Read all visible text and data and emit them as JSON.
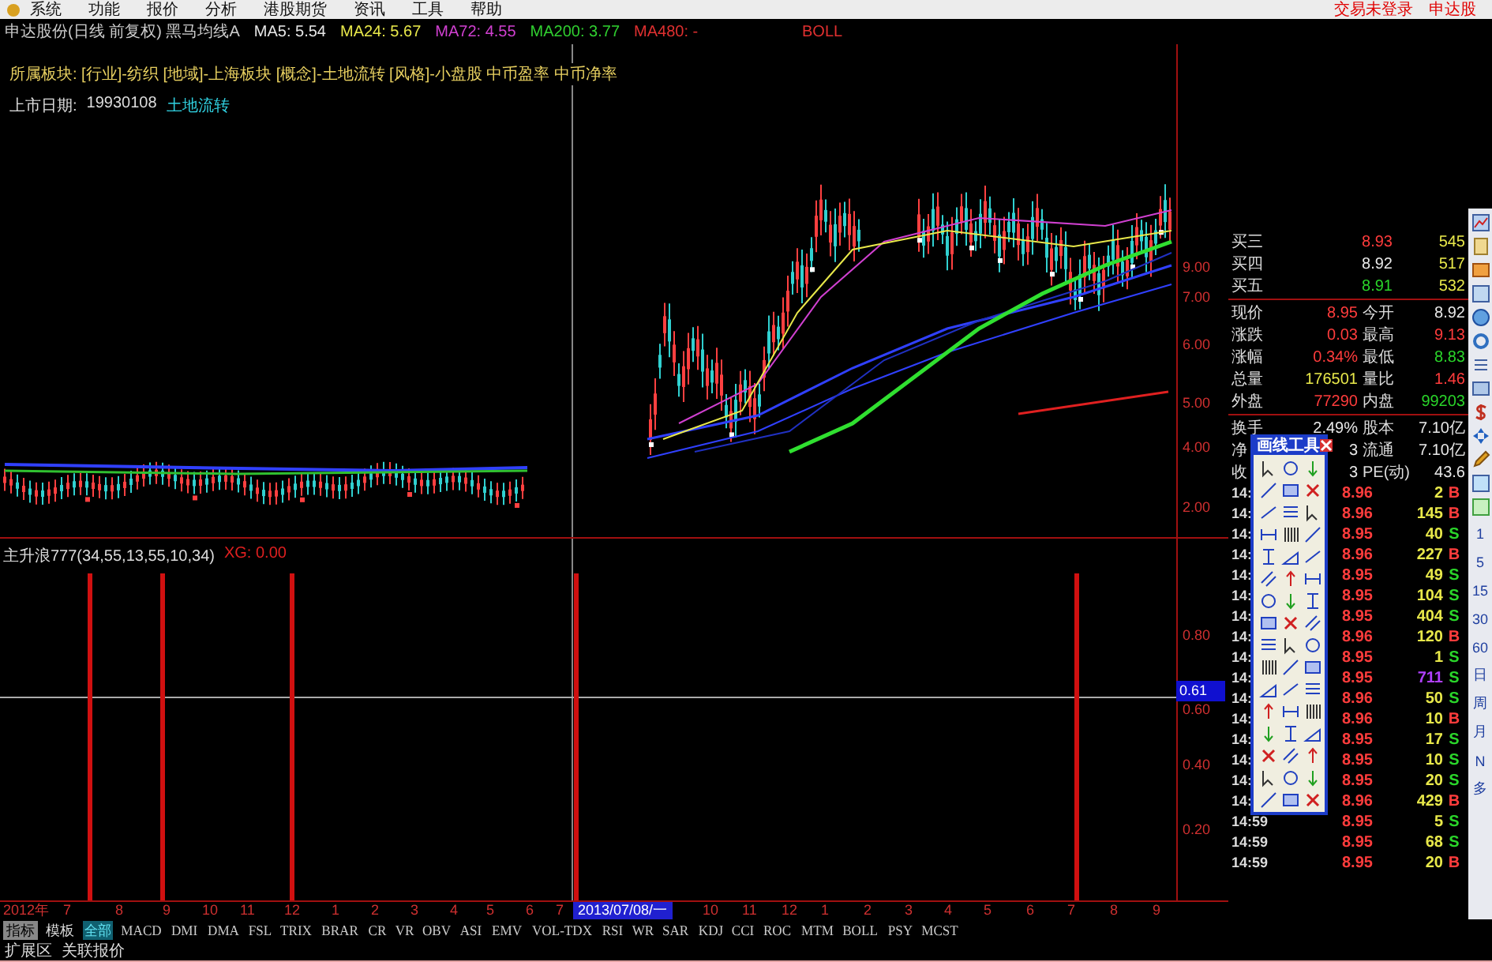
{
  "menu_bar": {
    "items": [
      "系统",
      "功能",
      "报价",
      "分析",
      "港股期货",
      "资讯",
      "工具",
      "帮助"
    ],
    "status": [
      "交易未登录",
      "申达股"
    ]
  },
  "chart_header": {
    "title": "申达股份(日线 前复权) 黑马均线A",
    "indicators": [
      {
        "label": "MA5: 5.54",
        "color": "#e6e6e6"
      },
      {
        "label": "MA24: 5.67",
        "color": "#e8e84a"
      },
      {
        "label": "MA72: 4.55",
        "color": "#d040d0"
      },
      {
        "label": "MA200: 3.77",
        "color": "#30d030"
      },
      {
        "label": "MA480: -",
        "color": "#e03030"
      }
    ],
    "extra": "BOLL"
  },
  "price_pane": {
    "sector": "所属板块: [行业]-纺织 [地域]-上海板块 [概念]-土地流转 [风格]-小盘股 中币盈率 中币净率",
    "listing": {
      "label": "上市日期:",
      "date": "19930108",
      "tag": "土地流转"
    },
    "axis_labels": [
      "9.00",
      "7.00",
      "6.00",
      "5.00",
      "4.00",
      "2.00"
    ]
  },
  "indicator_pane": {
    "name": "主升浪777(34,55,13,55,10,34)",
    "reading": "XG: 0.00",
    "axis_labels": [
      "0.80",
      "0.60",
      "0.40",
      "0.20"
    ],
    "cursor_value": "0.61"
  },
  "date_axis": [
    {
      "text": "2012年",
      "kind": "tick"
    },
    {
      "text": "7",
      "kind": "tick"
    },
    {
      "text": "8",
      "kind": "tick"
    },
    {
      "text": "9",
      "kind": "tick"
    },
    {
      "text": "10",
      "kind": "tick"
    },
    {
      "text": "11",
      "kind": "tick"
    },
    {
      "text": "12",
      "kind": "tick"
    },
    {
      "text": "1",
      "kind": "tick"
    },
    {
      "text": "2",
      "kind": "tick"
    },
    {
      "text": "3",
      "kind": "tick"
    },
    {
      "text": "4",
      "kind": "tick"
    },
    {
      "text": "5",
      "kind": "tick"
    },
    {
      "text": "6",
      "kind": "tick"
    },
    {
      "text": "7",
      "kind": "tick"
    },
    {
      "text": "2013/07/08/一",
      "kind": "cursor"
    },
    {
      "text": "10",
      "kind": "tick"
    },
    {
      "text": "11",
      "kind": "tick"
    },
    {
      "text": "12",
      "kind": "tick"
    },
    {
      "text": "1",
      "kind": "tick"
    },
    {
      "text": "2",
      "kind": "tick"
    },
    {
      "text": "3",
      "kind": "tick"
    },
    {
      "text": "4",
      "kind": "tick"
    },
    {
      "text": "5",
      "kind": "tick"
    },
    {
      "text": "6",
      "kind": "tick"
    },
    {
      "text": "7",
      "kind": "tick"
    },
    {
      "text": "8",
      "kind": "tick"
    },
    {
      "text": "9",
      "kind": "tick"
    }
  ],
  "quote": {
    "bids": [
      {
        "label": "买三",
        "price": "8.93",
        "color": "#ff3c3c",
        "volume": "545"
      },
      {
        "label": "买四",
        "price": "8.92",
        "color": "#e8e8e8",
        "volume": "517"
      },
      {
        "label": "买五",
        "price": "8.91",
        "color": "#2ad52a",
        "volume": "532"
      }
    ],
    "stats": [
      [
        {
          "label": "现价",
          "value": "8.95",
          "color": "#ff3c3c"
        },
        {
          "label": "今开",
          "value": "8.92",
          "color": "#e8e8e8"
        }
      ],
      [
        {
          "label": "涨跌",
          "value": "0.03",
          "color": "#ff3c3c"
        },
        {
          "label": "最高",
          "value": "9.13",
          "color": "#ff3c3c"
        }
      ],
      [
        {
          "label": "涨幅",
          "value": "0.34%",
          "color": "#ff3c3c"
        },
        {
          "label": "最低",
          "value": "8.83",
          "color": "#2ad52a"
        }
      ],
      [
        {
          "label": "总量",
          "value": "176501",
          "color": "#e8e84a"
        },
        {
          "label": "量比",
          "value": "1.46",
          "color": "#ff3c3c"
        }
      ],
      [
        {
          "label": "外盘",
          "value": "77290",
          "color": "#ff3c3c"
        },
        {
          "label": "内盘",
          "value": "99203",
          "color": "#2ad52a"
        }
      ]
    ],
    "stats2": [
      [
        {
          "label": "换手",
          "value": "2.49%",
          "color": "#e8e8e8"
        },
        {
          "label": "股本",
          "value": "7.10亿",
          "color": "#e8e8e8"
        }
      ],
      [
        {
          "label": "净",
          "value": "3",
          "color": "#e8e8e8"
        },
        {
          "label": "流通",
          "value": "7.10亿",
          "color": "#e8e8e8"
        }
      ],
      [
        {
          "label": "收",
          "value": "3",
          "color": "#e8e8e8"
        },
        {
          "label": "PE(动)",
          "value": "43.6",
          "color": "#e8e8e8"
        }
      ]
    ],
    "ticks": [
      {
        "time": "14:",
        "price": "8.96",
        "color": "#ff3c3c",
        "volume": "2",
        "large": false,
        "side": "B",
        "buy": true
      },
      {
        "time": "14:",
        "price": "8.96",
        "color": "#ff3c3c",
        "volume": "145",
        "large": false,
        "side": "B",
        "buy": true
      },
      {
        "time": "14:",
        "price": "8.95",
        "color": "#ff3c3c",
        "volume": "40",
        "large": false,
        "side": "S",
        "buy": false
      },
      {
        "time": "14:",
        "price": "8.96",
        "color": "#ff3c3c",
        "volume": "227",
        "large": false,
        "side": "B",
        "buy": true
      },
      {
        "time": "14:",
        "price": "8.95",
        "color": "#ff3c3c",
        "volume": "49",
        "large": false,
        "side": "S",
        "buy": false
      },
      {
        "time": "14:",
        "price": "8.95",
        "color": "#ff3c3c",
        "volume": "104",
        "large": false,
        "side": "S",
        "buy": false
      },
      {
        "time": "14:",
        "price": "8.95",
        "color": "#ff3c3c",
        "volume": "404",
        "large": false,
        "side": "S",
        "buy": false
      },
      {
        "time": "14:",
        "price": "8.96",
        "color": "#ff3c3c",
        "volume": "120",
        "large": false,
        "side": "B",
        "buy": true
      },
      {
        "time": "14:",
        "price": "8.95",
        "color": "#ff3c3c",
        "volume": "1",
        "large": false,
        "side": "S",
        "buy": false
      },
      {
        "time": "14:",
        "price": "8.95",
        "color": "#ff3c3c",
        "volume": "711",
        "large": true,
        "side": "S",
        "buy": false
      },
      {
        "time": "14:",
        "price": "8.96",
        "color": "#ff3c3c",
        "volume": "50",
        "large": false,
        "side": "S",
        "buy": false
      },
      {
        "time": "14:",
        "price": "8.96",
        "color": "#ff3c3c",
        "volume": "10",
        "large": false,
        "side": "B",
        "buy": true
      },
      {
        "time": "14:",
        "price": "8.95",
        "color": "#ff3c3c",
        "volume": "17",
        "large": false,
        "side": "S",
        "buy": false
      },
      {
        "time": "14:",
        "price": "8.95",
        "color": "#ff3c3c",
        "volume": "10",
        "large": false,
        "side": "S",
        "buy": false
      },
      {
        "time": "14:",
        "price": "8.95",
        "color": "#ff3c3c",
        "volume": "20",
        "large": false,
        "side": "S",
        "buy": false
      },
      {
        "time": "14:",
        "price": "8.96",
        "color": "#ff3c3c",
        "volume": "429",
        "large": false,
        "side": "B",
        "buy": true
      },
      {
        "time": "14:59",
        "price": "8.95",
        "color": "#ff3c3c",
        "volume": "5",
        "large": false,
        "side": "S",
        "buy": false
      },
      {
        "time": "14:59",
        "price": "8.95",
        "color": "#ff3c3c",
        "volume": "68",
        "large": false,
        "side": "S",
        "buy": false
      },
      {
        "time": "14:59",
        "price": "8.95",
        "color": "#ff3c3c",
        "volume": "20",
        "large": false,
        "side": "B",
        "buy": true
      }
    ]
  },
  "drawing_tools": {
    "title": "画线工具"
  },
  "side_toolbar": {
    "periods": [
      "1",
      "5",
      "15",
      "30",
      "60",
      "日",
      "周",
      "月",
      "N",
      "多"
    ]
  },
  "indicator_tabs": {
    "buttons": [
      "指标",
      "模板"
    ],
    "tabs": [
      {
        "label": "全部",
        "selected": true
      },
      {
        "label": "MACD",
        "selected": false
      },
      {
        "label": "DMI",
        "selected": false
      },
      {
        "label": "DMA",
        "selected": false
      },
      {
        "label": "FSL",
        "selected": false
      },
      {
        "label": "TRIX",
        "selected": false
      },
      {
        "label": "BRAR",
        "selected": false
      },
      {
        "label": "CR",
        "selected": false
      },
      {
        "label": "VR",
        "selected": false
      },
      {
        "label": "OBV",
        "selected": false
      },
      {
        "label": "ASI",
        "selected": false
      },
      {
        "label": "EMV",
        "selected": false
      },
      {
        "label": "VOL-TDX",
        "selected": false
      },
      {
        "label": "RSI",
        "selected": false
      },
      {
        "label": "WR",
        "selected": false
      },
      {
        "label": "SAR",
        "selected": false
      },
      {
        "label": "KDJ",
        "selected": false
      },
      {
        "label": "CCI",
        "selected": false
      },
      {
        "label": "ROC",
        "selected": false
      },
      {
        "label": "MTM",
        "selected": false
      },
      {
        "label": "BOLL",
        "selected": false
      },
      {
        "label": "PSY",
        "selected": false
      },
      {
        "label": "MCST",
        "selected": false
      }
    ]
  },
  "bottom_bar": {
    "items": [
      "扩展区",
      "关联报价"
    ]
  }
}
